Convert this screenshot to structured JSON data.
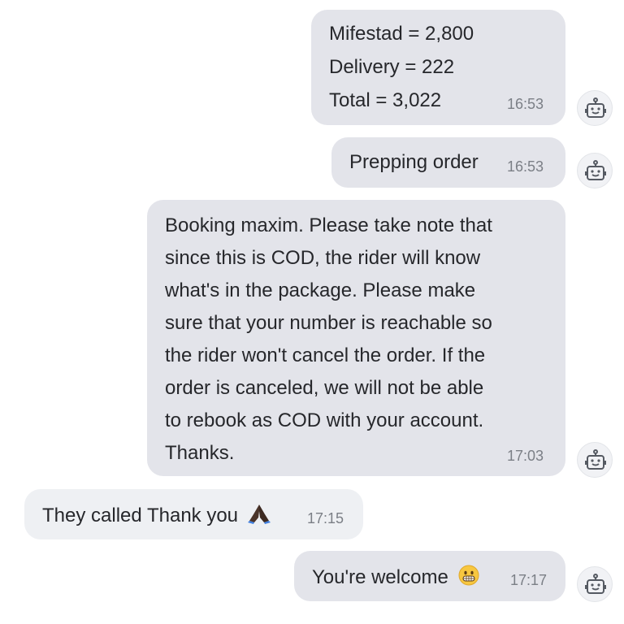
{
  "messages": [
    {
      "direction": "outgoing",
      "lines": [
        "Mifestad = 2,800",
        "Delivery = 222",
        "Total = 3,022"
      ],
      "time": "16:53",
      "avatar_icon": "robot-icon"
    },
    {
      "direction": "outgoing",
      "text": "Prepping order",
      "time": "16:53",
      "avatar_icon": "robot-icon"
    },
    {
      "direction": "outgoing",
      "lines": [
        "Booking maxim. Please take note that",
        "since this is COD, the rider will know",
        "what's in the package. Please make",
        "sure that your number is reachable so",
        "the rider won't cancel the order. If the",
        "order is canceled, we will not be able",
        "to rebook as COD with your account.",
        "Thanks."
      ],
      "time": "17:03",
      "avatar_icon": "robot-icon"
    },
    {
      "direction": "incoming",
      "text": "They called Thank you",
      "emoji": "folded-hands-emoji",
      "time": "17:15"
    },
    {
      "direction": "outgoing",
      "text": "You're welcome",
      "emoji": "grinning-face-emoji",
      "time": "17:17",
      "avatar_icon": "robot-icon"
    }
  ],
  "colors": {
    "outgoing_bubble": "#e3e4ea",
    "incoming_bubble": "#eef0f3",
    "text": "#26272b",
    "timestamp": "#7b7f86",
    "background": "#ffffff"
  }
}
